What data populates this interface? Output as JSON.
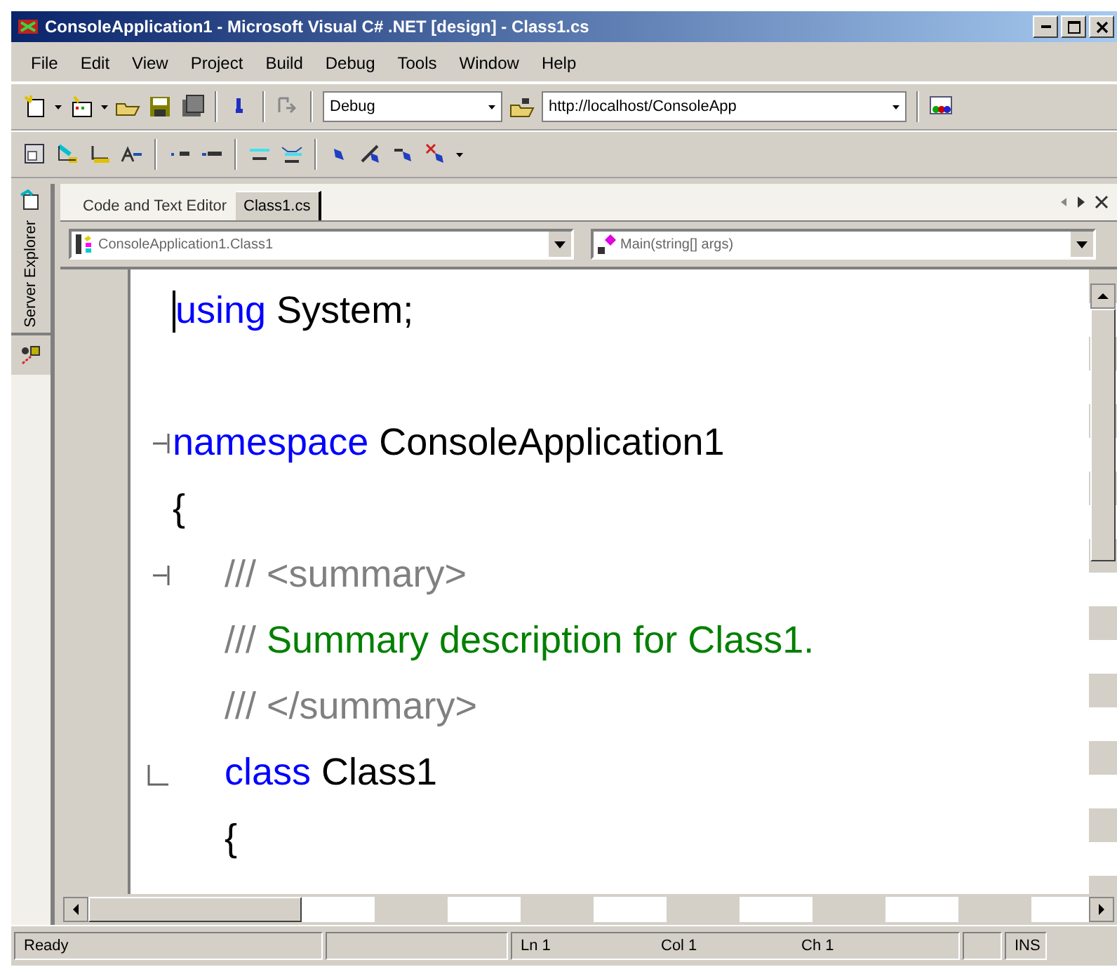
{
  "window": {
    "title": "ConsoleApplication1 - Microsoft Visual C# .NET [design] - Class1.cs"
  },
  "menu": [
    "File",
    "Edit",
    "View",
    "Project",
    "Build",
    "Debug",
    "Tools",
    "Window",
    "Help"
  ],
  "toolbar": {
    "configuration": "Debug",
    "find_combo": "http://localhost/ConsoleApp"
  },
  "side_toolbar": {
    "label": "Server Explorer"
  },
  "tabs": [
    {
      "label": "Code and Text Editor",
      "selected": false
    },
    {
      "label": "Class1.cs",
      "selected": true
    }
  ],
  "type_dropdown": {
    "value": "ConsoleApplication1.Class1"
  },
  "member_dropdown": {
    "value": "Main(string[] args)"
  },
  "code_lines": [
    {
      "kind": "code",
      "caret": true,
      "tokens": [
        {
          "kind": "keyword",
          "text": "using"
        },
        {
          "kind": "plain",
          "text": " System;"
        }
      ]
    },
    {
      "kind": "blank"
    },
    {
      "kind": "code",
      "collapse_marker": true,
      "tokens": [
        {
          "kind": "keyword",
          "text": "namespace"
        },
        {
          "kind": "plain",
          "text": " ConsoleApplication1"
        }
      ]
    },
    {
      "kind": "code",
      "tokens": [
        {
          "kind": "plain",
          "text": "{"
        }
      ]
    },
    {
      "kind": "code",
      "collapse_marker": true,
      "indented": true,
      "tokens": [
        {
          "kind": "doc",
          "text": "/// <summary>"
        }
      ]
    },
    {
      "kind": "code",
      "indented": true,
      "tokens": [
        {
          "kind": "doc",
          "text": "///"
        },
        {
          "kind": "comment",
          "text": " Summary description for Class1."
        }
      ]
    },
    {
      "kind": "code",
      "indented": true,
      "tokens": [
        {
          "kind": "doc",
          "text": "/// </summary>"
        }
      ]
    },
    {
      "kind": "code",
      "block_marker": true,
      "indented": true,
      "tokens": [
        {
          "kind": "keyword",
          "text": "class"
        },
        {
          "kind": "plain",
          "text": " Class1"
        }
      ]
    },
    {
      "kind": "code",
      "indented": true,
      "tokens": [
        {
          "kind": "plain",
          "text": "{"
        }
      ]
    }
  ],
  "status_bar": {
    "message": "Ready",
    "line": "Ln 1",
    "column": "Col 1",
    "char": "Ch 1",
    "mode": "INS"
  }
}
